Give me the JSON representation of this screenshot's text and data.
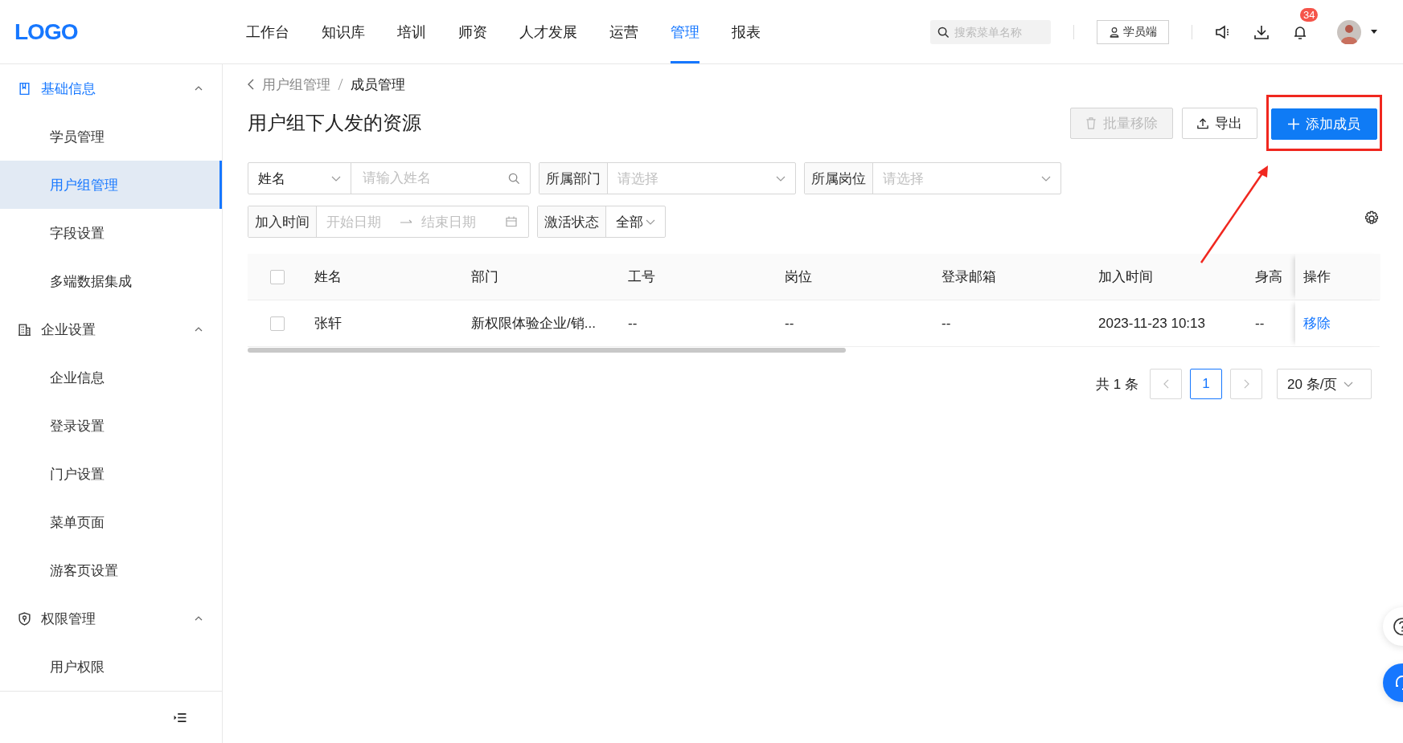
{
  "logo": "LOGO",
  "nav": [
    {
      "label": "工作台",
      "selected": false
    },
    {
      "label": "知识库",
      "selected": false
    },
    {
      "label": "培训",
      "selected": false
    },
    {
      "label": "师资",
      "selected": false
    },
    {
      "label": "人才发展",
      "selected": false
    },
    {
      "label": "运营",
      "selected": false
    },
    {
      "label": "管理",
      "selected": true
    },
    {
      "label": "报表",
      "selected": false
    }
  ],
  "search": {
    "placeholder": "搜索菜单名称"
  },
  "student_button": "学员端",
  "notifications": {
    "badge": "34"
  },
  "sidebar": {
    "groups": [
      {
        "label": "基础信息",
        "active": true,
        "expanded": true,
        "items": [
          {
            "label": "学员管理",
            "selected": false
          },
          {
            "label": "用户组管理",
            "selected": true
          },
          {
            "label": "字段设置",
            "selected": false
          },
          {
            "label": "多端数据集成",
            "selected": false
          }
        ]
      },
      {
        "label": "企业设置",
        "active": false,
        "expanded": true,
        "items": [
          {
            "label": "企业信息",
            "selected": false
          },
          {
            "label": "登录设置",
            "selected": false
          },
          {
            "label": "门户设置",
            "selected": false
          },
          {
            "label": "菜单页面",
            "selected": false
          },
          {
            "label": "游客页设置",
            "selected": false
          }
        ]
      },
      {
        "label": "权限管理",
        "active": false,
        "expanded": true,
        "items": [
          {
            "label": "用户权限",
            "selected": false
          }
        ]
      }
    ]
  },
  "breadcrumb": [
    {
      "label": "用户组管理",
      "current": false
    },
    {
      "label": "成员管理",
      "current": true
    }
  ],
  "title": "用户组下人发的资源",
  "actions": [
    {
      "label": "批量移除",
      "kind": "delete",
      "disabled": true,
      "primary": false,
      "highlighted": false
    },
    {
      "label": "导出",
      "kind": "export",
      "disabled": false,
      "primary": false,
      "highlighted": false
    },
    {
      "label": "添加成员",
      "kind": "add",
      "disabled": false,
      "primary": true,
      "highlighted": true
    }
  ],
  "filters": [
    [
      {
        "kind": "select-input",
        "select": "姓名",
        "placeholder": "请输入姓名"
      },
      {
        "kind": "select",
        "label": "所属部门",
        "placeholder": "请选择"
      },
      {
        "kind": "select",
        "label": "所属岗位",
        "placeholder": "请选择"
      }
    ],
    [
      {
        "kind": "daterange",
        "label": "加入时间",
        "start": "开始日期",
        "end": "结束日期"
      },
      {
        "kind": "select",
        "label": "激活状态",
        "value": "全部"
      }
    ]
  ],
  "table": {
    "select_all": {
      "checked": false
    },
    "columns": [
      "姓名",
      "部门",
      "工号",
      "岗位",
      "登录邮箱",
      "加入时间",
      "身高",
      "操作"
    ],
    "rows": [
      {
        "checked": false,
        "cells": [
          "张轩",
          "新权限体验企业/销...",
          "--",
          "--",
          "--",
          "2023-11-23 10:13",
          "--"
        ],
        "action": "移除"
      }
    ]
  },
  "pagination": {
    "total": "共 1 条",
    "pages": [
      {
        "label": "1",
        "selected": true
      }
    ],
    "page_size": "20 条/页"
  }
}
